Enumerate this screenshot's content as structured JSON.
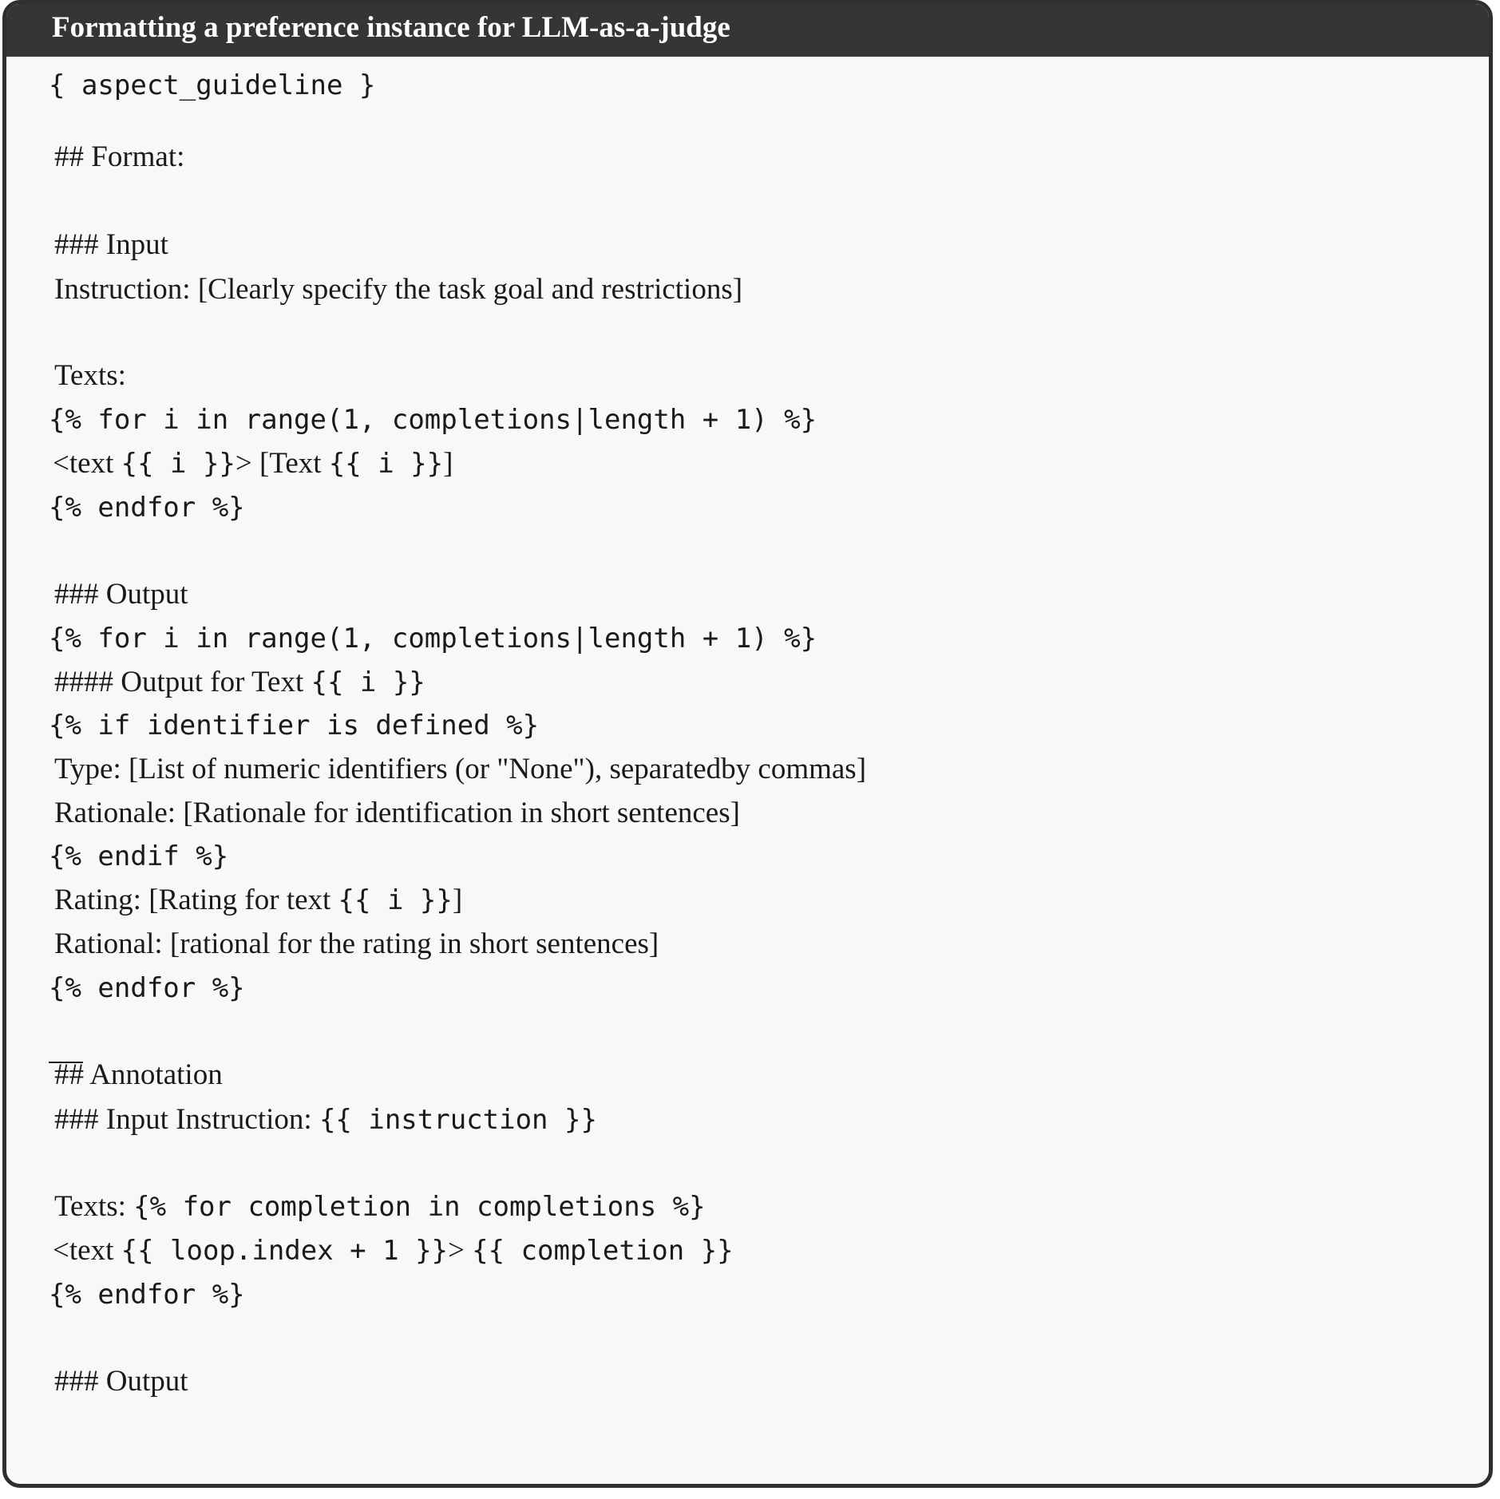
{
  "header": {
    "title": "Formatting a preference instance for LLM-as-a-judge"
  },
  "lines": {
    "l01": {
      "code": "{ aspect_guideline }"
    },
    "l02": {
      "text": "## Format:"
    },
    "l03": {
      "text": "### Input"
    },
    "l04": {
      "text": "Instruction: [Clearly specify the task goal and restrictions]"
    },
    "l05": {
      "text": "Texts:"
    },
    "l06": {
      "code": "{% for i in range(1, completions|length + 1) %}"
    },
    "l07": {
      "a": "<text ",
      "b": "{{ i }}",
      "c": "> [Text ",
      "d": "{{ i }}",
      "e": "]"
    },
    "l08": {
      "code": "{% endfor %}"
    },
    "l09": {
      "text": "### Output"
    },
    "l10": {
      "code": "{% for i in range(1, completions|length + 1) %}"
    },
    "l11": {
      "a": "#### Output for Text ",
      "b": "{{ i }}"
    },
    "l12": {
      "code": "{% if identifier is defined %}"
    },
    "l13": {
      "text": "Type: [List of numeric identifiers (or \"None\"), separatedby commas]"
    },
    "l14": {
      "text": "Rationale: [Rationale for identification in short sentences]"
    },
    "l15": {
      "code": "{% endif %}"
    },
    "l16": {
      "a": "Rating: [Rating for text ",
      "b": "{{ i }}",
      "c": "]"
    },
    "l17": {
      "text": "Rational: [rational for the rating in short sentences]"
    },
    "l18": {
      "code": "{% endfor %}"
    },
    "l19": {
      "text": "## Annotation"
    },
    "l20": {
      "a": "### Input Instruction: ",
      "b": "{{ instruction }}"
    },
    "l21": {
      "a": "Texts: ",
      "b": "{% for completion in completions %}"
    },
    "l22": {
      "a": "<text ",
      "b": "{{ loop.index + 1 }}",
      "c": "> ",
      "d": "{{ completion }}"
    },
    "l23": {
      "code": "{% endfor %}"
    },
    "l24": {
      "text": "### Output"
    }
  }
}
